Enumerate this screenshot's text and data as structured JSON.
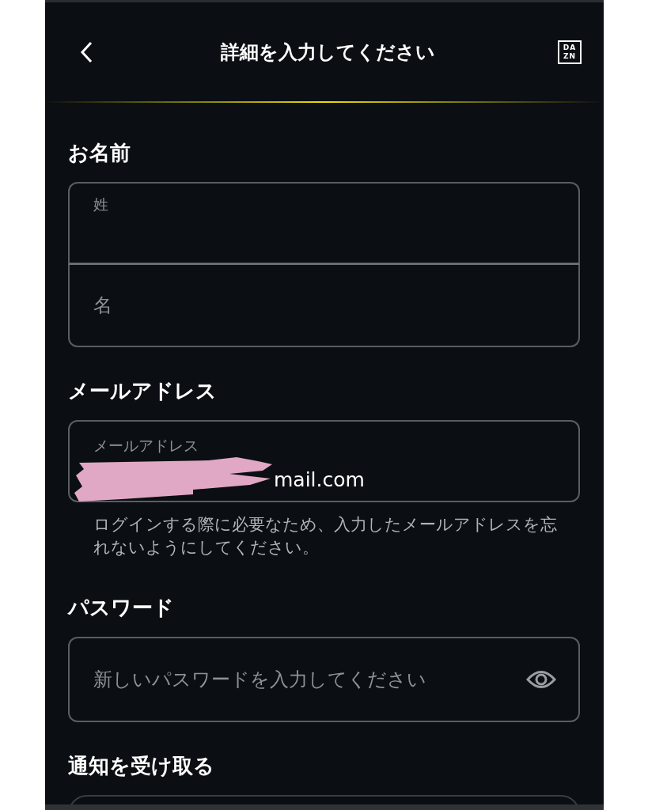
{
  "header": {
    "title": "詳細を入力してください",
    "logo": [
      "DA",
      "ZN"
    ]
  },
  "sections": [
    {
      "kind": "name",
      "label": "お名前",
      "fields": [
        {
          "label": "姓"
        },
        {
          "placeholder": "名"
        }
      ]
    },
    {
      "kind": "email",
      "label": "メールアドレス",
      "field": {
        "label": "メールアドレス",
        "value": "mail.com",
        "redacted": true
      },
      "helper": "ログインする際に必要なため、入力したメールアドレスを忘れないようにしてください。"
    },
    {
      "kind": "password",
      "label": "パスワード",
      "field": {
        "placeholder": "新しいパスワードを入力してください"
      }
    },
    {
      "kind": "notifications",
      "label": "通知を受け取る"
    }
  ]
}
